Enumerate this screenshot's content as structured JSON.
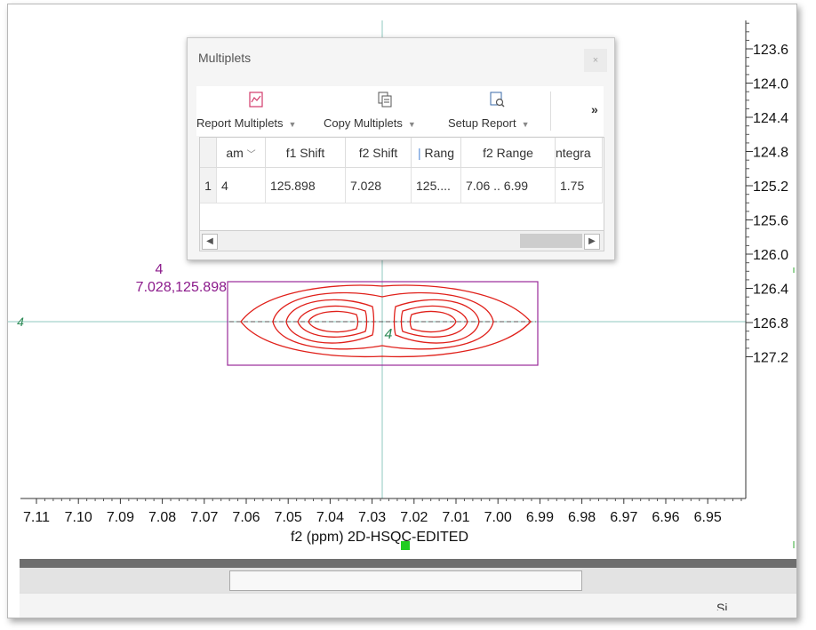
{
  "spectrum": {
    "x_axis_label": "f2 (ppm) 2D-HSQC-EDITED",
    "x_ticks": [
      "7.11",
      "7.10",
      "7.09",
      "7.08",
      "7.07",
      "7.06",
      "7.05",
      "7.04",
      "7.03",
      "7.02",
      "7.01",
      "7.00",
      "6.99",
      "6.98",
      "6.97",
      "6.96",
      "6.95"
    ],
    "y_ticks": [
      "123.6",
      "124.0",
      "124.4",
      "124.8",
      "125.2",
      "125.6",
      "126.0",
      "126.4",
      "126.8",
      "127.2"
    ],
    "peak": {
      "number": "4",
      "coords": "7.028,125.898",
      "center_label": "4",
      "left_marker": "4"
    },
    "colors": {
      "contour": "#e0201a",
      "box": "#9a2a9a",
      "label": "#8b1a8b",
      "crosshair": "#8fc9bf",
      "marker": "#2e8b57"
    }
  },
  "dialog": {
    "title": "Multiplets",
    "close": "×",
    "toolbar": {
      "report": "Report Multiplets",
      "copy": "Copy Multiplets",
      "setup": "Setup Report",
      "more": "»"
    },
    "table": {
      "headers": [
        "",
        "am",
        "f1 Shift",
        "f2 Shift",
        "Rang",
        "f2 Range",
        "ntegra"
      ],
      "rows": [
        [
          "1",
          "4",
          "125.898",
          "7.028",
          "125....",
          "7.06 .. 6.99",
          "1.75"
        ]
      ]
    }
  },
  "footer": {
    "cut_label": "Si…"
  }
}
